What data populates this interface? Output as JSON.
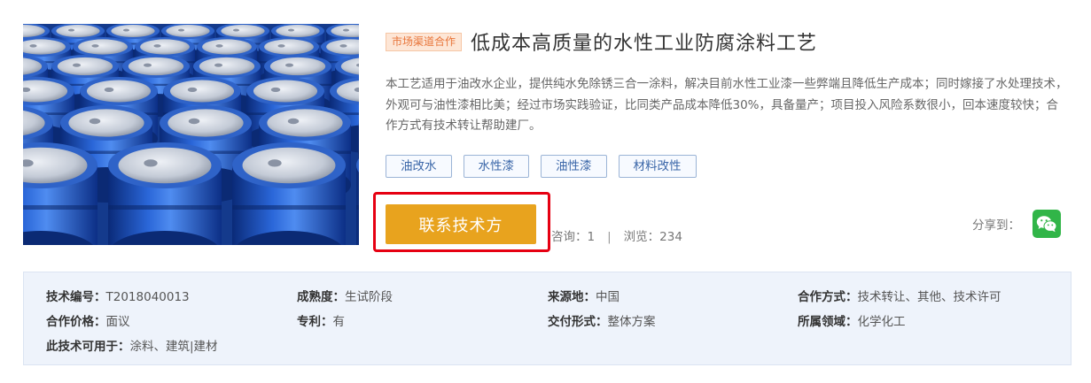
{
  "product": {
    "channel_badge": "市场渠道合作",
    "title": "低成本高质量的水性工业防腐涂料工艺",
    "description": "本工艺适用于油改水企业，提供纯水免除锈三合一涂料，解决目前水性工业漆一些弊端且降低生产成本；同时嫁接了水处理技术，外观可与油性漆相比美；经过市场实践验证，比同类产品成本降低30%，具备量产；项目投入风险系数很小，回本速度较快；合作方式有技术转让帮助建厂。",
    "keywords": [
      "油改水",
      "水性漆",
      "油性漆",
      "材料改性"
    ],
    "image_subject": "blue plastic chemical barrels"
  },
  "actions": {
    "contact_label": "联系技术方",
    "contact_color": "#e8a31e",
    "highlight_color": "#e60012"
  },
  "stats": {
    "consult_label": "咨询：",
    "consult_count": "1",
    "separator": "|",
    "view_label": "浏览：",
    "view_count": "234"
  },
  "share": {
    "label": "分享到：",
    "icon": "wechat-icon"
  },
  "details": {
    "tech_no_label": "技术编号：",
    "tech_no": "T2018040013",
    "maturity_label": "成熟度：",
    "maturity": "生试阶段",
    "origin_label": "来源地：",
    "origin": "中国",
    "coop_mode_label": "合作方式：",
    "coop_mode": "技术转让、其他、技术许可",
    "price_label": "合作价格：",
    "price": "面议",
    "patent_label": "专利：",
    "patent": "有",
    "delivery_label": "交付形式：",
    "delivery": "整体方案",
    "field_label": "所属领域：",
    "field": "化学化工",
    "applicable_label": "此技术可用于：",
    "applicable": "涂料、建筑|建材"
  }
}
